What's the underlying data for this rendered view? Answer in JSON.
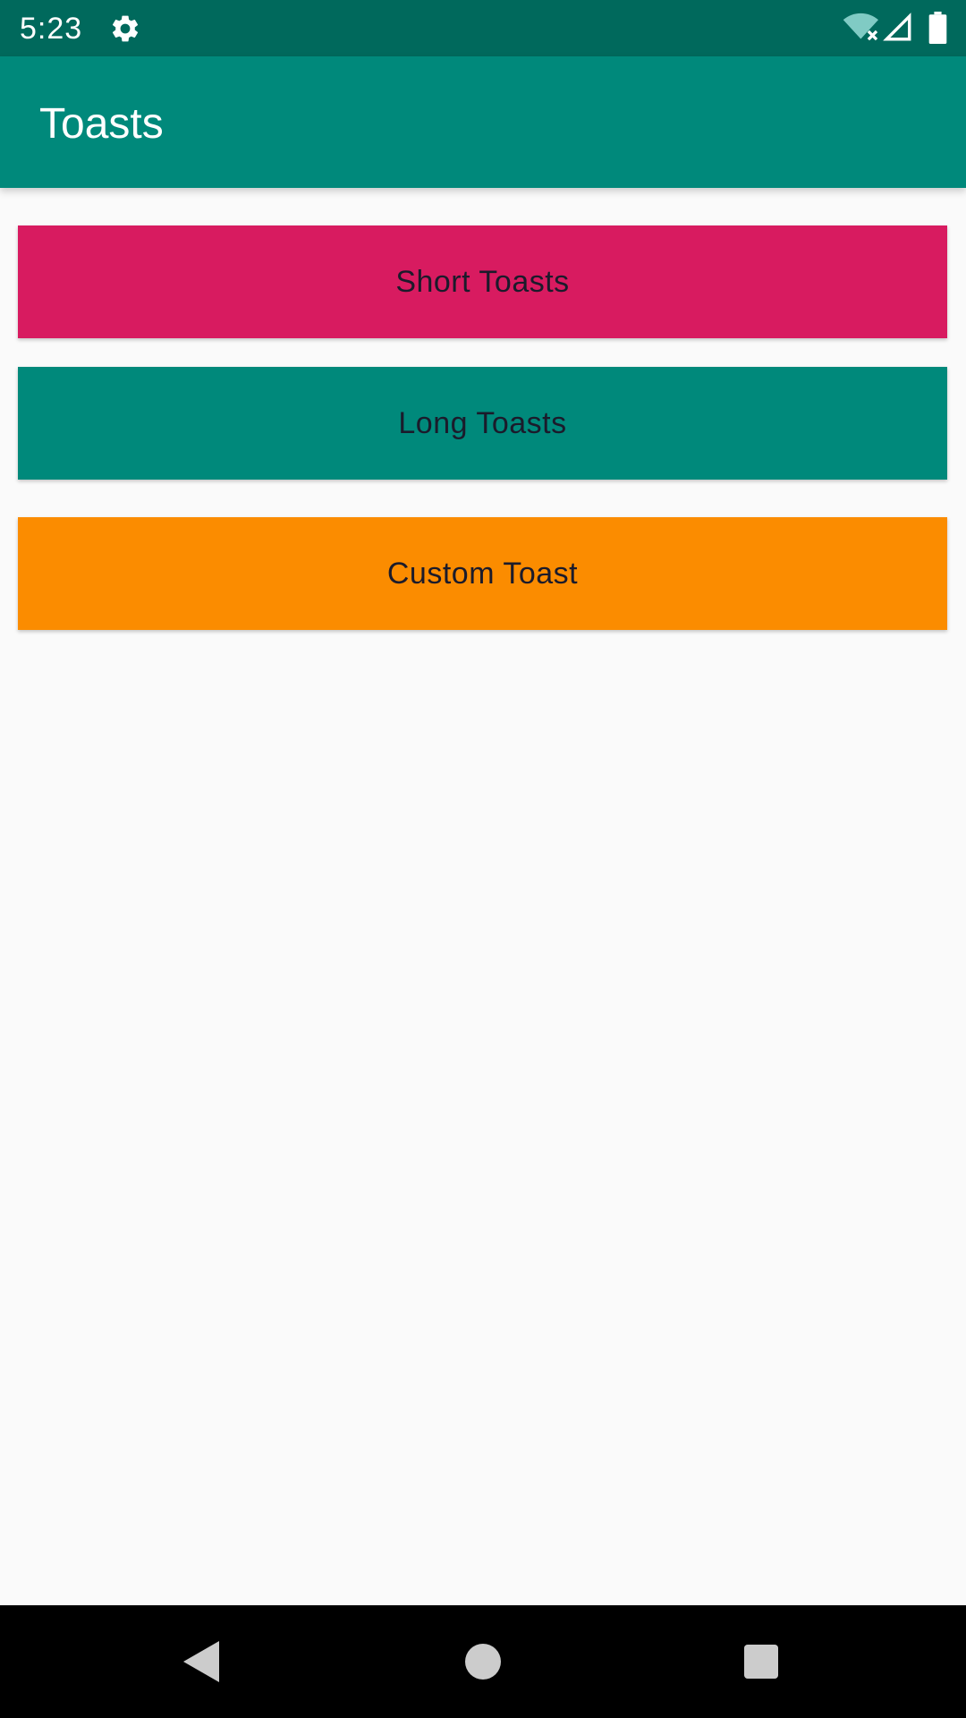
{
  "status_bar": {
    "time": "5:23",
    "icons": [
      "gear-icon",
      "wifi-off-icon",
      "cell-signal-icon",
      "battery-icon"
    ],
    "background": "#00695c"
  },
  "app_bar": {
    "title": "Toasts",
    "background": "#00897b"
  },
  "buttons": [
    {
      "label": "Short Toasts",
      "color": "#d81b60"
    },
    {
      "label": "Long Toasts",
      "color": "#00897b"
    },
    {
      "label": "Custom Toast",
      "color": "#fb8c00"
    }
  ],
  "nav_bar": {
    "icons": [
      "back-icon",
      "home-icon",
      "recents-icon"
    ]
  }
}
